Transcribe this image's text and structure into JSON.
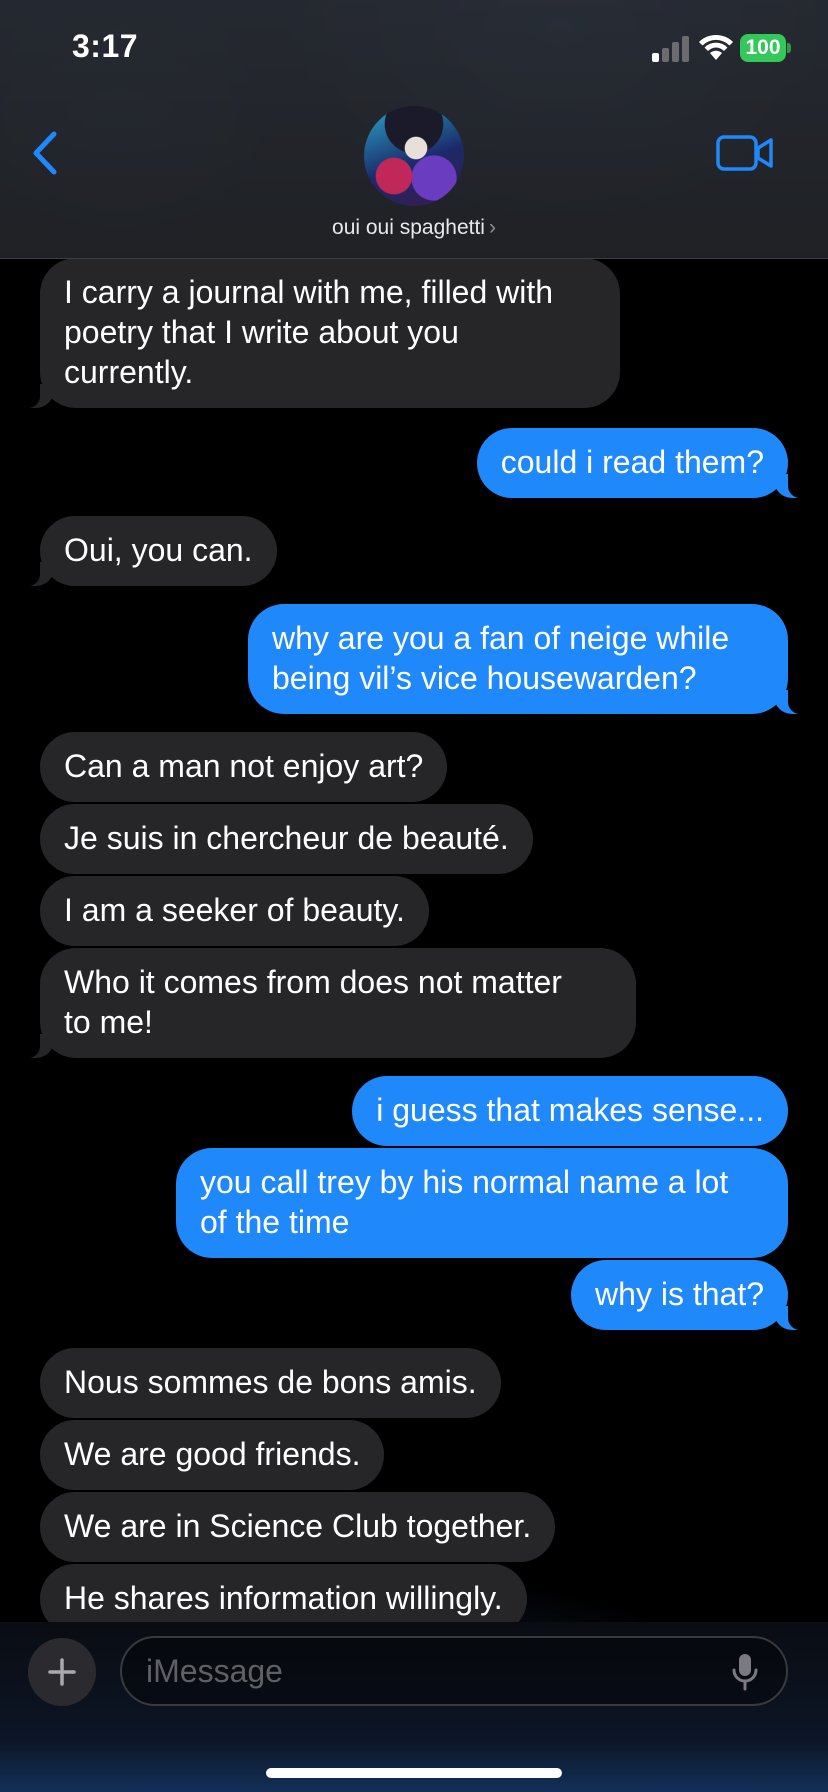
{
  "status_bar": {
    "time": "3:17",
    "battery": "100"
  },
  "header": {
    "contact_name": "oui oui spaghetti",
    "name_chevron": "›"
  },
  "messages": [
    {
      "from": "them",
      "text": "I carry a journal with me, filled with\npoetry that I write about you\ncurrently."
    },
    {
      "from": "me",
      "text": "could i read them?"
    },
    {
      "from": "them",
      "text": "Oui, you can."
    },
    {
      "from": "me",
      "text": "why are you a fan of neige while\nbeing vil’s vice housewarden?"
    },
    {
      "from": "them",
      "text": "Can a man not enjoy art?"
    },
    {
      "from": "them",
      "text": "Je suis in chercheur de beauté."
    },
    {
      "from": "them",
      "text": "I am a seeker of beauty."
    },
    {
      "from": "them",
      "text": "Who it comes from does not matter\nto me!"
    },
    {
      "from": "me",
      "text": "i guess that makes sense..."
    },
    {
      "from": "me",
      "text": "you call trey by his normal name a lot\nof the time"
    },
    {
      "from": "me",
      "text": "why is that?"
    },
    {
      "from": "them",
      "text": "Nous sommes de bons amis."
    },
    {
      "from": "them",
      "text": "We are good friends."
    },
    {
      "from": "them",
      "text": "We are in Science Club together."
    },
    {
      "from": "them",
      "text": "He shares information willingly."
    }
  ],
  "composer": {
    "placeholder": "iMessage"
  },
  "colors": {
    "accent": "#1f88fb",
    "incoming_bubble": "#262629",
    "battery": "#34c759"
  },
  "icons": [
    "back-chevron-icon",
    "video-camera-icon",
    "plus-icon",
    "microphone-icon",
    "signal-icon",
    "wifi-icon"
  ]
}
